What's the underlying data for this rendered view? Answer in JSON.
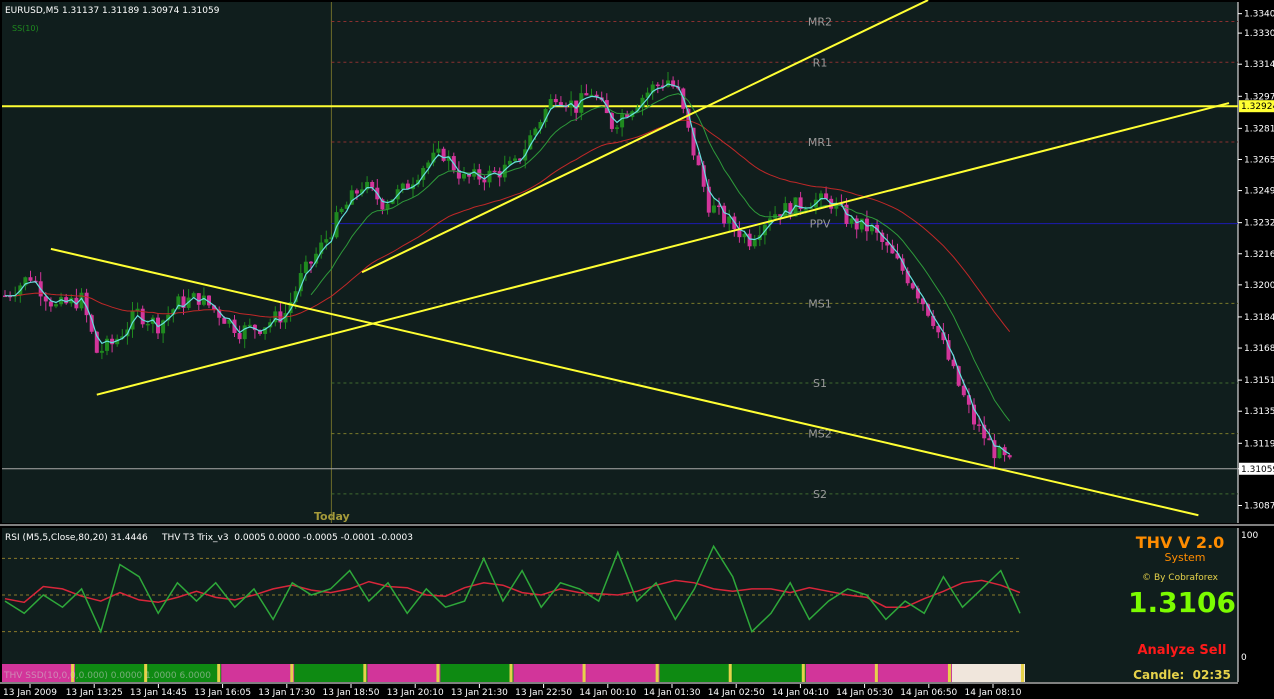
{
  "window": {
    "symbol_header": "EURUSD,M5  1.31137 1.31189 1.30974 1.31059",
    "mini_label": "SS(10)",
    "today_label": "Today"
  },
  "colors": {
    "background": "#000000",
    "plot_bg": "#101e1d",
    "up_candle": "#1f8a1f",
    "down_candle": "#d2359a",
    "trendline": "#ffff33",
    "pivot_line": "#7a7a2a",
    "pivot_center": "#1b1bb0",
    "rsi": "#d8263a",
    "trix": "#2ea83a"
  },
  "chart_data": [
    {
      "type": "candlestick",
      "title": "EURUSD,M5",
      "ohlc_readout": {
        "open": 1.31137,
        "high": 1.31189,
        "low": 1.30974,
        "close": 1.31059
      },
      "ylim": [
        1.3078,
        1.3346
      ],
      "y_ticks": [
        "1.33400",
        "1.33300",
        "1.33140",
        "1.32975",
        "1.32810",
        "1.32650",
        "1.32490",
        "1.32325",
        "1.32165",
        "1.32005",
        "1.31840",
        "1.31680",
        "1.31515",
        "1.31355",
        "1.31190",
        "1.31059",
        "1.30870"
      ],
      "x_ticks": [
        "13 Jan 2009",
        "13 Jan 13:25",
        "13 Jan 14:45",
        "13 Jan 16:05",
        "13 Jan 17:30",
        "13 Jan 18:50",
        "13 Jan 20:10",
        "13 Jan 21:30",
        "13 Jan 22:50",
        "14 Jan 00:10",
        "14 Jan 01:30",
        "14 Jan 02:50",
        "14 Jan 04:10",
        "14 Jan 05:30",
        "14 Jan 06:50",
        "14 Jan 08:10"
      ],
      "x_range": [
        0,
        208
      ],
      "price_series": [
        [
          0,
          1.3195
        ],
        [
          5,
          1.3205
        ],
        [
          10,
          1.3189
        ],
        [
          15,
          1.3193
        ],
        [
          18,
          1.3166
        ],
        [
          21,
          1.317
        ],
        [
          26,
          1.3186
        ],
        [
          30,
          1.318
        ],
        [
          34,
          1.3191
        ],
        [
          38,
          1.3194
        ],
        [
          42,
          1.3186
        ],
        [
          46,
          1.3177
        ],
        [
          50,
          1.3179
        ],
        [
          55,
          1.3186
        ],
        [
          58,
          1.3204
        ],
        [
          62,
          1.322
        ],
        [
          66,
          1.3238
        ],
        [
          70,
          1.3252
        ],
        [
          74,
          1.3243
        ],
        [
          78,
          1.3249
        ],
        [
          82,
          1.3262
        ],
        [
          86,
          1.3268
        ],
        [
          90,
          1.3255
        ],
        [
          95,
          1.3257
        ],
        [
          100,
          1.3262
        ],
        [
          105,
          1.3286
        ],
        [
          108,
          1.3299
        ],
        [
          112,
          1.3292
        ],
        [
          115,
          1.33
        ],
        [
          119,
          1.3283
        ],
        [
          123,
          1.3293
        ],
        [
          127,
          1.3302
        ],
        [
          130,
          1.3306
        ],
        [
          132,
          1.3299
        ],
        [
          135,
          1.3269
        ],
        [
          138,
          1.3242
        ],
        [
          142,
          1.3232
        ],
        [
          146,
          1.3224
        ],
        [
          150,
          1.3237
        ],
        [
          154,
          1.324
        ],
        [
          158,
          1.3244
        ],
        [
          162,
          1.3243
        ],
        [
          166,
          1.3232
        ],
        [
          170,
          1.3229
        ],
        [
          174,
          1.3215
        ],
        [
          178,
          1.3201
        ],
        [
          182,
          1.3183
        ],
        [
          186,
          1.3155
        ],
        [
          190,
          1.313
        ],
        [
          194,
          1.3115
        ],
        [
          197,
          1.3108
        ]
      ],
      "pivot_levels": [
        {
          "label": "MR2",
          "value": 1.3336
        },
        {
          "label": "R1",
          "value": 1.3315
        },
        {
          "label": "MR1",
          "value": 1.3274
        },
        {
          "label": "PPV",
          "value": 1.3232
        },
        {
          "label": "MS1",
          "value": 1.3191
        },
        {
          "label": "S1",
          "value": 1.315
        },
        {
          "label": "MS2",
          "value": 1.3124
        },
        {
          "label": "S2",
          "value": 1.3093
        }
      ],
      "price_tags": [
        {
          "label": "1.32924",
          "value": 1.32924,
          "color": "#ffff33"
        },
        {
          "label": "1.31059",
          "value": 1.31059,
          "color": "#ffffff"
        }
      ],
      "horizontal_lines": [
        {
          "value": 1.32924,
          "color": "#ffff33"
        },
        {
          "value": 1.31059,
          "color": "#aaaaaa"
        }
      ],
      "trendlines": [
        {
          "from": [
            9,
            1.3219
          ],
          "to": [
            234,
            1.3082
          ]
        },
        {
          "from": [
            18,
            1.3144
          ],
          "to": [
            240,
            1.3294
          ]
        },
        {
          "from": [
            70,
            1.3207
          ],
          "to": [
            181,
            1.3347
          ]
        }
      ],
      "today_marker_x": 64
    },
    {
      "type": "line",
      "title": "RSI (M5,5,Close,80,20) 31.4446     THV T3 Trix_v3  0.0005 0.0000 -0.0005 -0.0001 -0.0003",
      "ylim": [
        0,
        100
      ],
      "y_ticks": [
        "100",
        "0"
      ],
      "levels": [
        80,
        50,
        20
      ],
      "series": [
        {
          "name": "RSI",
          "color": "#d8263a",
          "values": [
            47,
            44,
            57,
            55,
            49,
            45,
            52,
            46,
            44,
            48,
            53,
            48,
            46,
            50,
            55,
            58,
            54,
            52,
            55,
            61,
            57,
            56,
            50,
            49,
            56,
            60,
            58,
            52,
            50,
            55,
            52,
            51,
            50,
            53,
            58,
            62,
            60,
            55,
            53,
            55,
            55,
            52,
            56,
            53,
            50,
            48,
            40,
            40,
            47,
            53,
            60,
            62,
            58,
            52
          ]
        },
        {
          "name": "THV T3 Trix_v3",
          "color": "#2ea83a",
          "values": [
            45,
            35,
            50,
            40,
            55,
            20,
            75,
            65,
            35,
            60,
            45,
            60,
            40,
            55,
            30,
            60,
            50,
            55,
            70,
            45,
            60,
            35,
            55,
            40,
            45,
            80,
            45,
            70,
            40,
            60,
            55,
            45,
            85,
            45,
            60,
            30,
            55,
            90,
            65,
            20,
            35,
            60,
            30,
            45,
            55,
            50,
            30,
            45,
            35,
            65,
            40,
            55,
            70,
            35
          ]
        }
      ],
      "side_panel": {
        "title": "THV V 2.0",
        "subtitle": "System",
        "credit": "© By Cobraforex",
        "price": "1.3106",
        "signal": "Analyze Sell",
        "candle": "Candle:  02:35"
      },
      "signal_bar": {
        "legend_overlay": "THV SSD(10,0,0,0.000)  0.0000 1.0000 6.0000",
        "segments": [
          "red",
          "green",
          "green",
          "red",
          "green",
          "red",
          "green",
          "red",
          "red",
          "green",
          "green",
          "red",
          "red",
          "white"
        ]
      }
    }
  ]
}
